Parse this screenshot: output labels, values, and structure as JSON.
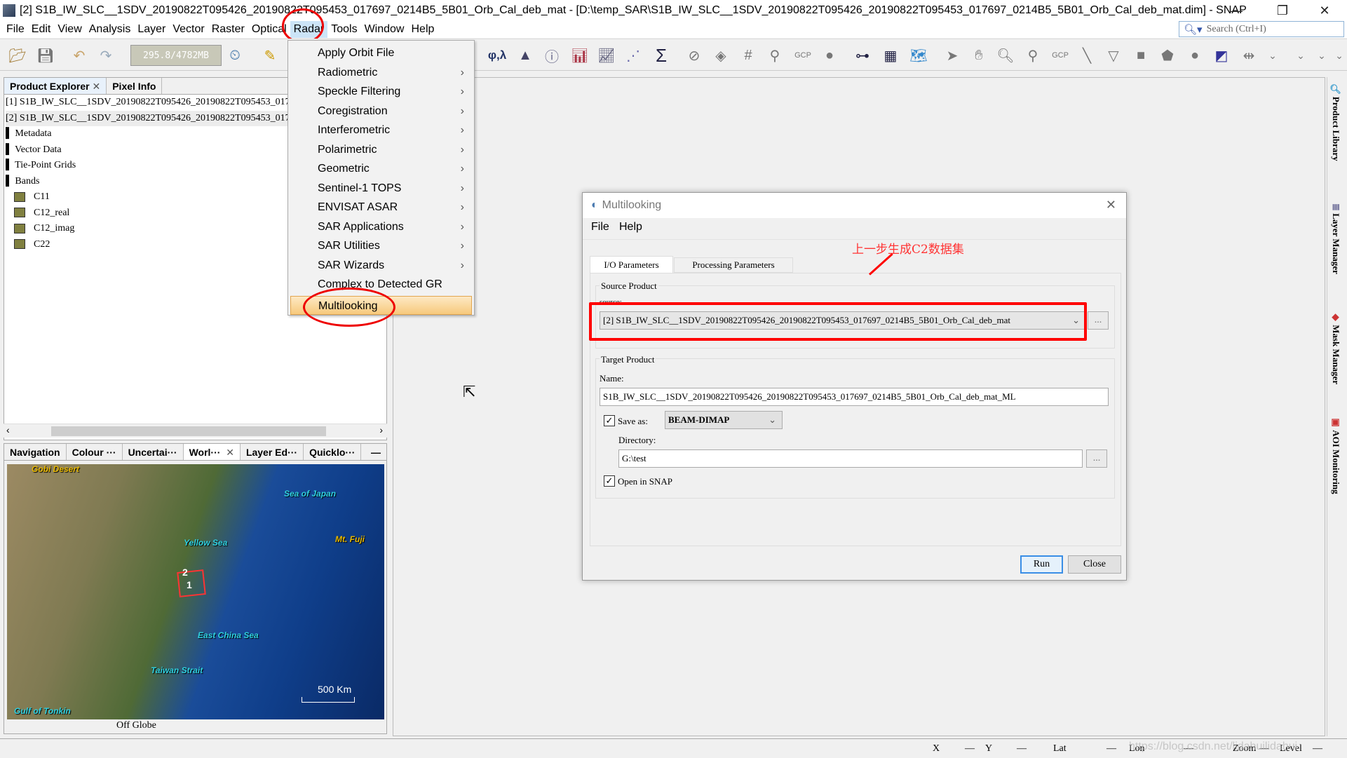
{
  "window": {
    "title": "[2] S1B_IW_SLC__1SDV_20190822T095426_20190822T095453_017697_0214B5_5B01_Orb_Cal_deb_mat - [D:\\temp_SAR\\S1B_IW_SLC__1SDV_20190822T095426_20190822T095453_017697_0214B5_5B01_Orb_Cal_deb_mat.dim] - SNAP",
    "minimize": "—",
    "restore": "❐",
    "close": "✕"
  },
  "menubar": [
    "File",
    "Edit",
    "View",
    "Analysis",
    "Layer",
    "Vector",
    "Raster",
    "Optical",
    "Radar",
    "Tools",
    "Window",
    "Help"
  ],
  "search": {
    "placeholder": "Search (Ctrl+I)"
  },
  "toolbar": {
    "memory": "295.8/4782MB",
    "geo_label": "φ,λ",
    "sum": "Σ",
    "gcp": "GCP"
  },
  "product_explorer": {
    "tabs": [
      "Product Explorer",
      "Pixel Info"
    ],
    "close": "✕",
    "products": [
      "[1] S1B_IW_SLC__1SDV_20190822T095426_20190822T095453_017697_0214B5_5B01",
      "[2] S1B_IW_SLC__1SDV_20190822T095426_20190822T095453_017697_0214B5_5B01"
    ],
    "nodes": [
      "Metadata",
      "Vector Data",
      "Tie-Point Grids",
      "Bands"
    ],
    "bands": [
      "C11",
      "C12_real",
      "C12_imag",
      "C22"
    ]
  },
  "bottom_panel": {
    "tabs": [
      "Navigation",
      "Colour ···",
      "Uncertai···",
      "Worl···",
      "Layer Ed···",
      "Quicklo···"
    ],
    "close": "✕",
    "minimize": "—",
    "map_labels": [
      "Gobi Desert",
      "Sea of Japan",
      "Yellow Sea",
      "Mt. Fuji",
      "East China Sea",
      "Taiwan Strait",
      "Gulf of Tonkin"
    ],
    "scale": "500 Km",
    "footprints": [
      "2",
      "1"
    ],
    "status": "Off Globe"
  },
  "radar_menu": {
    "items": [
      {
        "label": "Apply Orbit File",
        "submenu": false
      },
      {
        "label": "Radiometric",
        "submenu": true
      },
      {
        "label": "Speckle Filtering",
        "submenu": true
      },
      {
        "label": "Coregistration",
        "submenu": true
      },
      {
        "label": "Interferometric",
        "submenu": true
      },
      {
        "label": "Polarimetric",
        "submenu": true
      },
      {
        "label": "Geometric",
        "submenu": true
      },
      {
        "label": "Sentinel-1 TOPS",
        "submenu": true
      },
      {
        "label": "ENVISAT ASAR",
        "submenu": true
      },
      {
        "label": "SAR Applications",
        "submenu": true
      },
      {
        "label": "SAR Utilities",
        "submenu": true
      },
      {
        "label": "SAR Wizards",
        "submenu": true
      },
      {
        "label": "Complex to Detected GR",
        "submenu": false
      },
      {
        "label": "Multilooking",
        "submenu": false,
        "highlighted": true
      }
    ],
    "arrow": "›"
  },
  "dialog": {
    "title": "Multilooking",
    "close": "✕",
    "menu": [
      "File",
      "Help"
    ],
    "tabs": [
      "I/O Parameters",
      "Processing Parameters"
    ],
    "source_group": "Source Product",
    "source_label": "source:",
    "source_value": "[2] S1B_IW_SLC__1SDV_20190822T095426_20190822T095453_017697_0214B5_5B01_Orb_Cal_deb_mat",
    "target_group": "Target Product",
    "name_label": "Name:",
    "name_value": "S1B_IW_SLC__1SDV_20190822T095426_20190822T095453_017697_0214B5_5B01_Orb_Cal_deb_mat_ML",
    "save_as_label": "Save as:",
    "save_as_checked": true,
    "format": "BEAM-DIMAP",
    "directory_label": "Directory:",
    "directory_value": "G:\\test",
    "browse": "...",
    "open_in_snap_label": "Open in SNAP",
    "open_in_snap_checked": true,
    "run": "Run",
    "close_btn": "Close"
  },
  "annotation": {
    "text": "上一步生成C2数据集",
    "color": "#ff0000"
  },
  "right_sidebar": [
    "Product Library",
    "Layer Manager",
    "Mask Manager",
    "AOI Monitoring"
  ],
  "statusbar": {
    "x": "X",
    "y": "Y",
    "lat": "Lat",
    "lon": "Lon",
    "zoom": "Zoom",
    "level": "Level",
    "dash": "—",
    "watermark": "https://blog.csdn.net/lidahuilidahui"
  }
}
